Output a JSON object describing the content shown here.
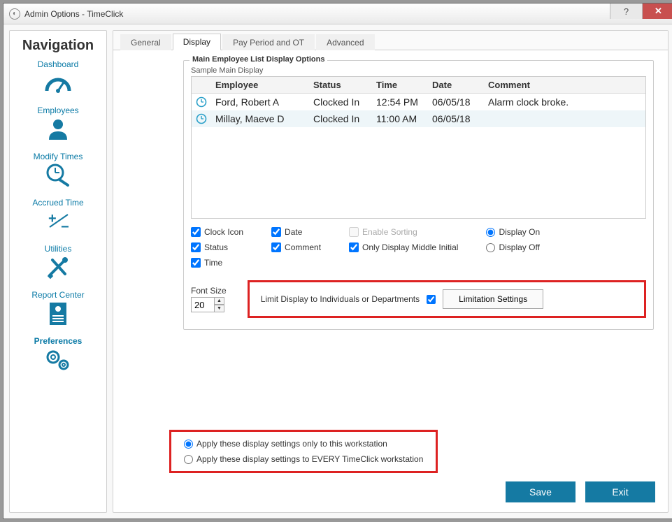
{
  "window": {
    "title": "Admin Options - TimeClick"
  },
  "sidebar": {
    "heading": "Navigation",
    "items": [
      {
        "label": "Dashboard"
      },
      {
        "label": "Employees"
      },
      {
        "label": "Modify Times"
      },
      {
        "label": "Accrued Time"
      },
      {
        "label": "Utilities"
      },
      {
        "label": "Report Center"
      },
      {
        "label": "Preferences"
      }
    ]
  },
  "tabs": {
    "items": [
      {
        "label": "General"
      },
      {
        "label": "Display"
      },
      {
        "label": "Pay Period and OT"
      },
      {
        "label": "Advanced"
      }
    ],
    "active_index": 1
  },
  "group": {
    "title": "Main Employee List Display Options",
    "sample_label": "Sample Main Display"
  },
  "table": {
    "headers": {
      "employee": "Employee",
      "status": "Status",
      "time": "Time",
      "date": "Date",
      "comment": "Comment"
    },
    "rows": [
      {
        "employee": "Ford, Robert A",
        "status": "Clocked In",
        "time": "12:54 PM",
        "date": "06/05/18",
        "comment": "Alarm clock broke."
      },
      {
        "employee": "Millay, Maeve D",
        "status": "Clocked In",
        "time": "11:00 AM",
        "date": "06/05/18",
        "comment": ""
      }
    ]
  },
  "checks": {
    "clock_icon": "Clock Icon",
    "status": "Status",
    "time": "Time",
    "date": "Date",
    "comment": "Comment",
    "enable_sorting": "Enable Sorting",
    "only_middle_initial": "Only Display Middle Initial"
  },
  "display_radio": {
    "on": "Display On",
    "off": "Display Off"
  },
  "font": {
    "label": "Font Size",
    "value": "20"
  },
  "limit": {
    "label": "Limit Display to Individuals or Departments",
    "button": "Limitation Settings"
  },
  "apply": {
    "this_only": "Apply these display settings only to this workstation",
    "every": "Apply these display settings to EVERY TimeClick workstation"
  },
  "footer": {
    "save": "Save",
    "exit": "Exit"
  }
}
